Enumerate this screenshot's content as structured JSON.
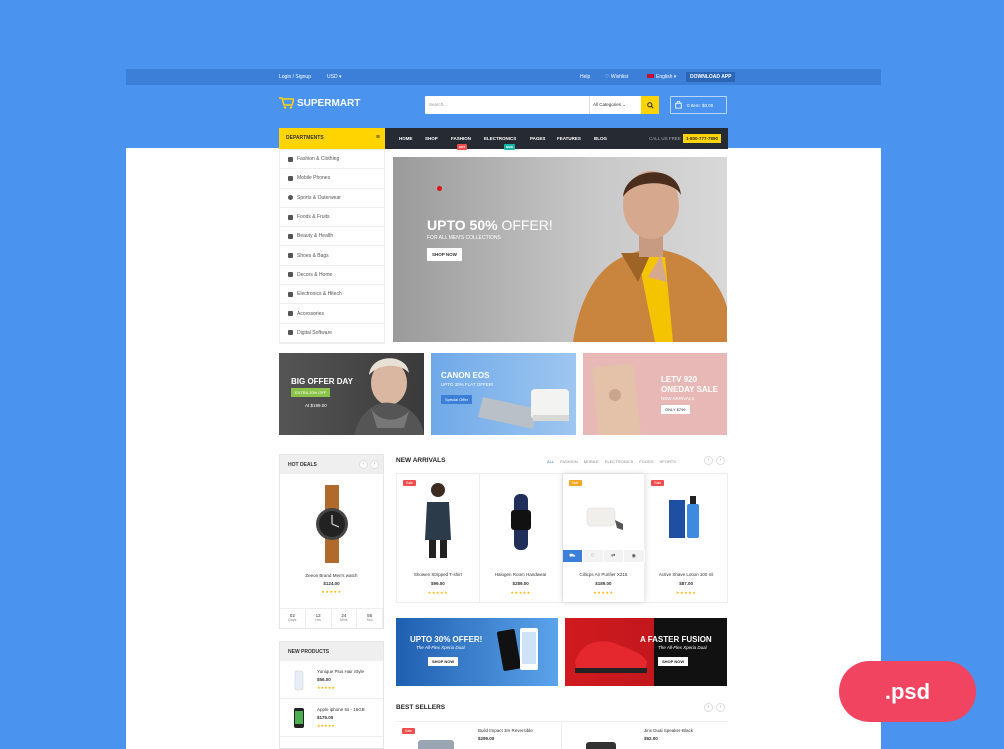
{
  "topbar": {
    "login": "Login / Signup",
    "currency": "USD ▾",
    "help": "Help",
    "wishlist": "♡ Wishlist",
    "language": "English ▾",
    "download": "DOWNLOAD APP"
  },
  "header": {
    "logo": "SUPERMART",
    "search_placeholder": "Search...",
    "category": "All Categories",
    "cart": "0 Item: $0.00"
  },
  "nav": {
    "departments": "DEPARTMENTS",
    "items": [
      "HOME",
      "SHOP",
      "FASHION",
      "ELECTRONICS",
      "PAGES",
      "FEATURES",
      "BLOG"
    ],
    "badge_hot": "HOT",
    "badge_new": "NEW",
    "call": "CALL US FREE",
    "phone": "1-800-777-7890"
  },
  "sidebar": {
    "items": [
      "Fashion & Clothing",
      "Mobile Phones",
      "Sports & Outerwear",
      "Foods & Fruits",
      "Beauty & Health",
      "Shoes & Bags",
      "Decors & Home",
      "Electronics & Hitech",
      "Accessories",
      "Digital Software"
    ]
  },
  "hero": {
    "headline_bold": "UPTO 50%",
    "headline_rest": "OFFER!",
    "sub": "FOR ALL MEN'S COLLECTIONS",
    "cta": "SHOP NOW"
  },
  "banners": {
    "b1_title": "BIG OFFER DAY",
    "b1_tag": "EXTRA 20% OFF",
    "b1_price": "At $199.00",
    "b2_title": "CANON EOS",
    "b2_sub": "UPTO 30% FLAT OFFER!",
    "b2_tag": "Special Offer",
    "b3_title1": "LETV 920",
    "b3_title2": "ONEDAY SALE",
    "b3_sub": "NEW ARRIVALS",
    "b3_tag": "ONLY $799"
  },
  "hot_deals": {
    "title": "HOT DEALS",
    "product": "Zeeon Brand Men's watch",
    "price": "$124.00",
    "stars": "★★★★★",
    "countdown": [
      {
        "value": "02",
        "label": "Days"
      },
      {
        "value": "12",
        "label": "Hrs"
      },
      {
        "value": "24",
        "label": "Mins"
      },
      {
        "value": "56",
        "label": "Sec"
      }
    ]
  },
  "new_products": {
    "title": "NEW PRODUCTS",
    "items": [
      {
        "name": "Yunique Plus Hair Style",
        "price": "$56.00",
        "stars": "★★★★★"
      },
      {
        "name": "Apple iphone 5s - 16GB",
        "price": "$175.00",
        "stars": "★★★★★"
      }
    ]
  },
  "arrivals": {
    "title": "NEW ARRIVALS",
    "tabs": [
      "ALL",
      "FASHION",
      "MOBILE",
      "ELECTRONICS",
      "FOODS",
      "SPORTS"
    ],
    "sale": "Sale",
    "products": [
      {
        "name": "Showen Stripped T-shirt",
        "price": "$99.00",
        "stars": "★★★★★"
      },
      {
        "name": "Halogen Room Handwear",
        "price": "$289.00",
        "stars": "★★★★★"
      },
      {
        "name": "Cillicps Air Purifier X215",
        "price": "$189.00",
        "stars": "★★★★★"
      },
      {
        "name": "Active Shave Lotion 100 ml",
        "price": "$87.00",
        "stars": "★★★★★"
      }
    ]
  },
  "promos": {
    "p1_title": "UPTO 30% OFFER!",
    "p1_sub": "The All-Flex Xperia Dual",
    "p1_cta": "SHOP NOW",
    "p2_title": "A FASTER FUSION",
    "p2_sub": "The All-Flex Xperia Dual",
    "p2_cta": "SHOP NOW"
  },
  "best_sellers": {
    "title": "BEST SELLERS",
    "sale": "Sale",
    "items": [
      {
        "name": "Build Impact 3m Reversible",
        "price": "$299.00"
      },
      {
        "name": "Jinx Dual Speaker-Black",
        "price": "$92.00"
      }
    ]
  },
  "psd_badge": ".psd",
  "colors": {
    "brand_blue": "#4a93ee",
    "accent_yellow": "#ffd400",
    "nav_dark": "#262b33",
    "sale_red": "#ef4d4d",
    "psd_pink": "#f04460"
  }
}
